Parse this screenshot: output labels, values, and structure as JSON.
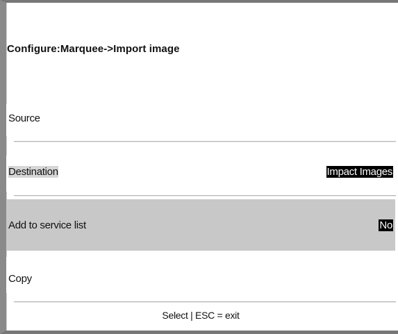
{
  "title": {
    "prefix": "Configure:",
    "path": "Marquee->Import image"
  },
  "menu": {
    "items": [
      {
        "label": "Source",
        "value": ""
      },
      {
        "label": "Destination",
        "value": "Impact Images"
      },
      {
        "label": "Add to service list",
        "value": "No"
      },
      {
        "label": "Copy",
        "value": ""
      }
    ]
  },
  "footer": {
    "hint": "Select | ESC = exit"
  }
}
